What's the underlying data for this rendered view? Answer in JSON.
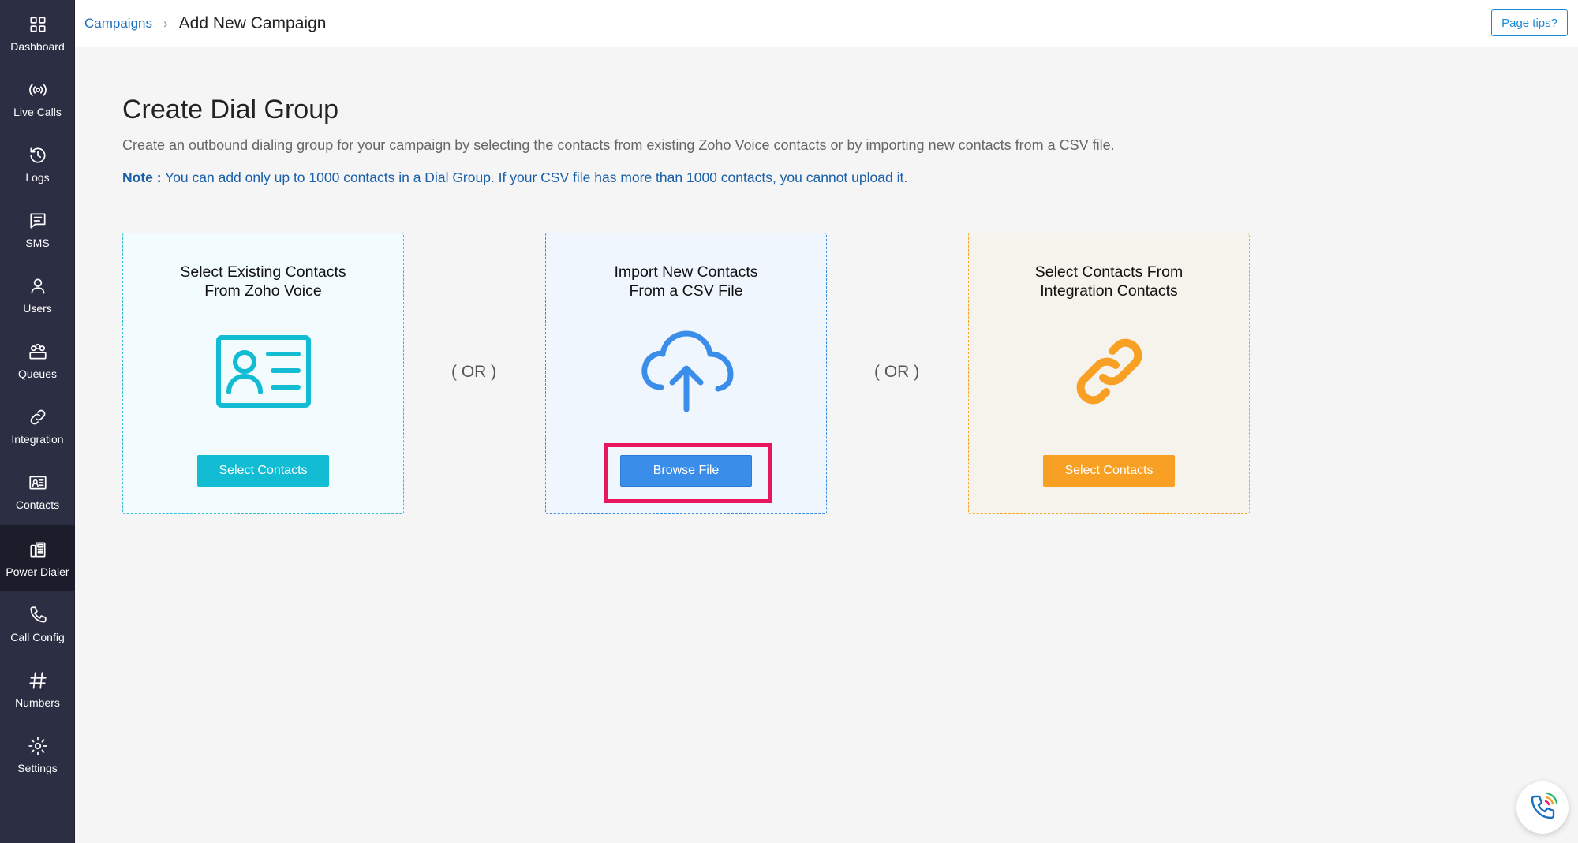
{
  "sidebar": {
    "items": [
      {
        "label": "Dashboard",
        "icon": "dashboard-icon"
      },
      {
        "label": "Live Calls",
        "icon": "live-calls-icon"
      },
      {
        "label": "Logs",
        "icon": "logs-icon"
      },
      {
        "label": "SMS",
        "icon": "sms-icon"
      },
      {
        "label": "Users",
        "icon": "users-icon"
      },
      {
        "label": "Queues",
        "icon": "queues-icon"
      },
      {
        "label": "Integration",
        "icon": "integration-icon"
      },
      {
        "label": "Contacts",
        "icon": "contacts-icon"
      },
      {
        "label": "Power Dialer",
        "icon": "power-dialer-icon",
        "active": true
      },
      {
        "label": "Call Config",
        "icon": "call-config-icon"
      },
      {
        "label": "Numbers",
        "icon": "numbers-icon"
      },
      {
        "label": "Settings",
        "icon": "settings-icon"
      }
    ]
  },
  "header": {
    "breadcrumb_parent": "Campaigns",
    "breadcrumb_separator": "›",
    "breadcrumb_current": "Add New Campaign",
    "page_tips_label": "Page tips?"
  },
  "main": {
    "title": "Create Dial Group",
    "description": "Create an outbound dialing group for your campaign by selecting the contacts from existing Zoho Voice contacts or by importing new contacts from a CSV file.",
    "note_label": "Note :",
    "note_text": "You can add only up to 1000 contacts in a Dial Group. If your CSV file has more than 1000 contacts, you cannot upload it.",
    "or_label": "( OR )",
    "cards": [
      {
        "title_line1": "Select Existing Contacts",
        "title_line2": "From Zoho Voice",
        "icon": "contact-card-icon",
        "button_label": "Select Contacts"
      },
      {
        "title_line1": "Import New Contacts",
        "title_line2": "From a CSV File",
        "icon": "cloud-upload-icon",
        "button_label": "Browse File"
      },
      {
        "title_line1": "Select Contacts From",
        "title_line2": "Integration Contacts",
        "icon": "link-icon",
        "button_label": "Select Contacts"
      }
    ]
  },
  "colors": {
    "sidebar_bg": "#2c2f44",
    "card1_accent": "#12bcd3",
    "card2_accent": "#3a8de8",
    "card3_accent": "#f8a024",
    "highlight": "#e8175d",
    "link": "#1a6fc0"
  }
}
